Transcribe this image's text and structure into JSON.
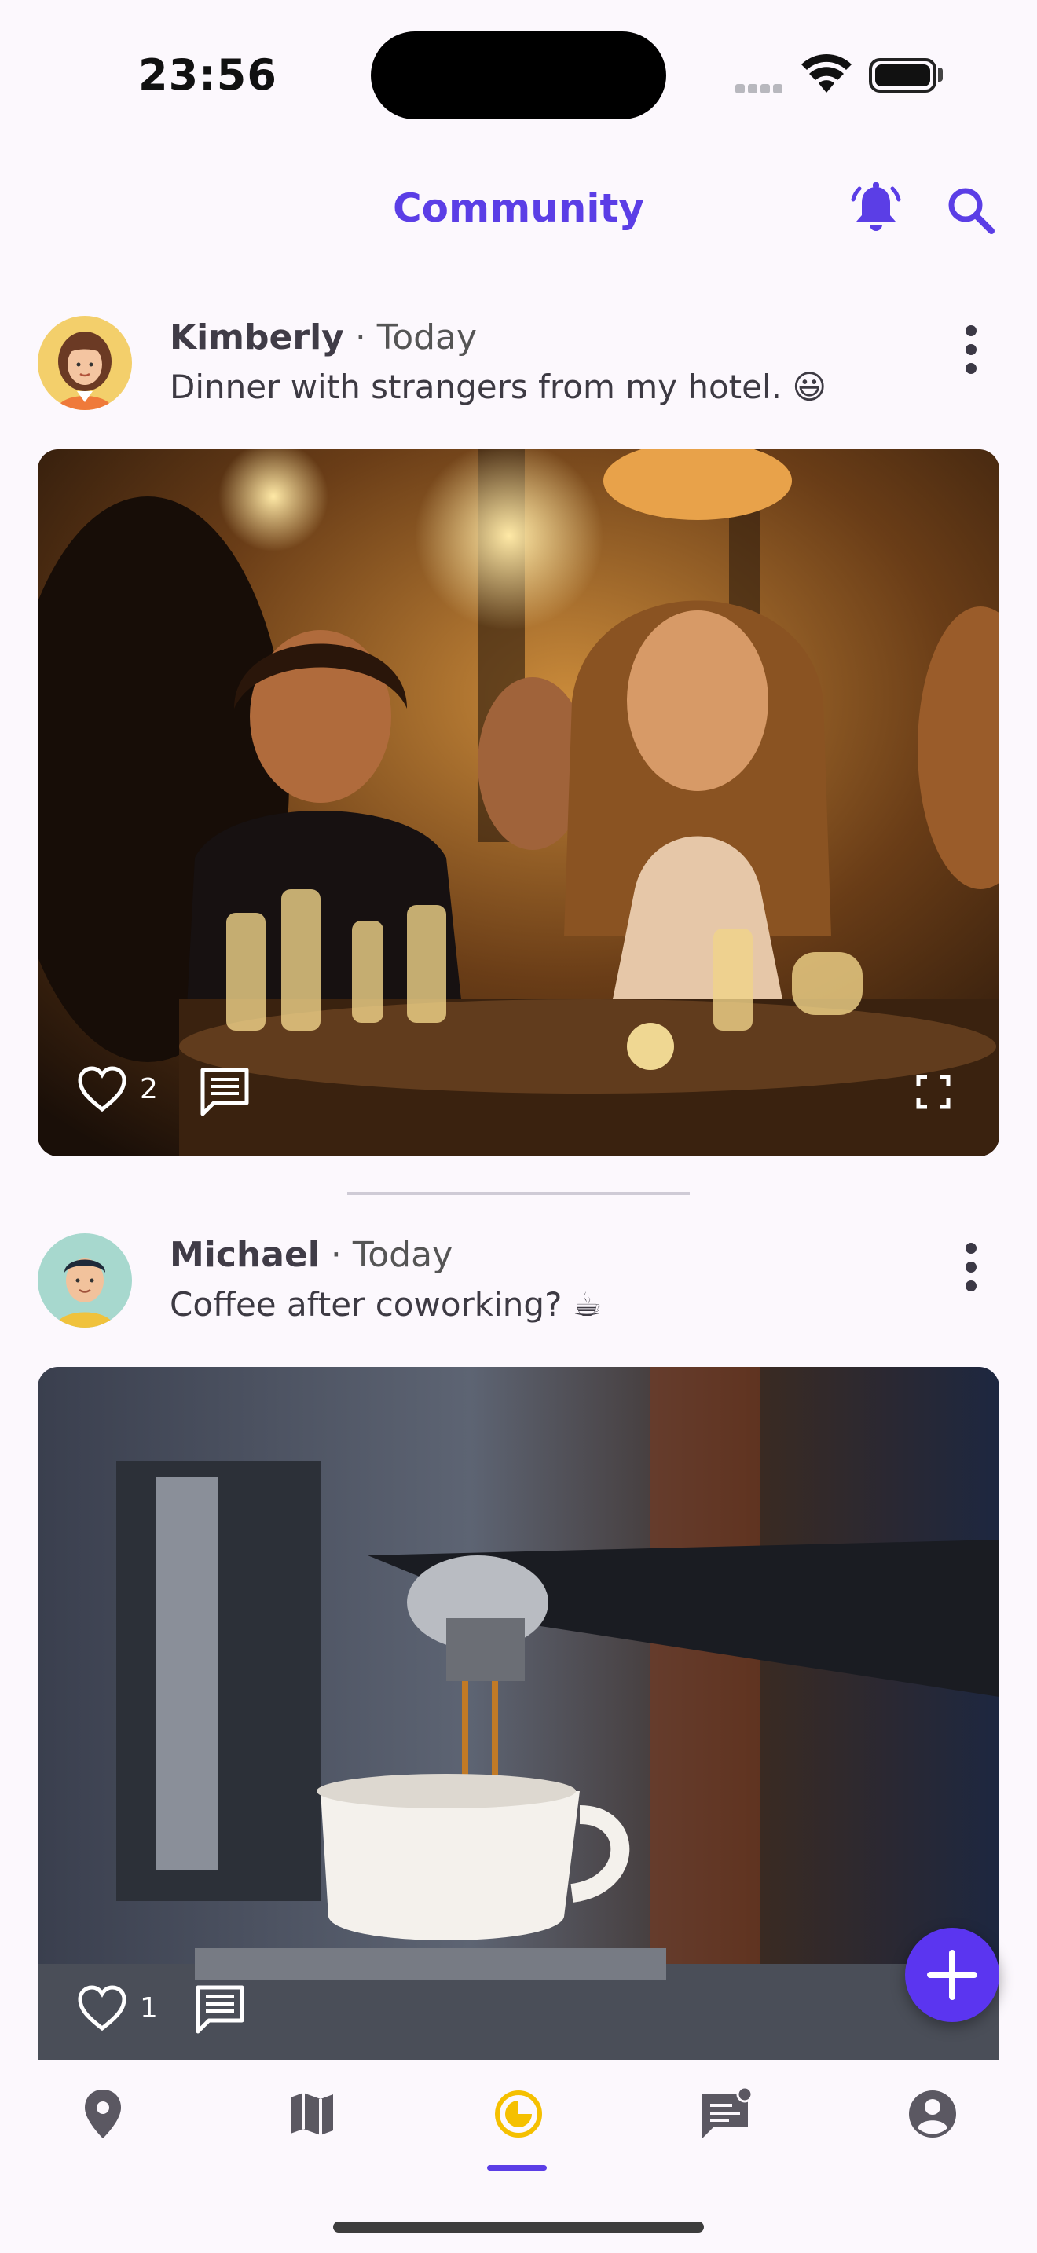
{
  "status_bar": {
    "time": "23:56"
  },
  "header": {
    "title": "Community"
  },
  "posts": [
    {
      "author": "Kimberly",
      "date": "· Today",
      "text": "Dinner with strangers from my hotel. 😃",
      "likes": "2"
    },
    {
      "author": "Michael",
      "date": "· Today",
      "text": "Coffee after coworking? ☕",
      "likes": "1"
    }
  ],
  "icons": {
    "header": [
      "bell-icon",
      "search-icon"
    ],
    "post_actions": [
      "heart-icon",
      "comment-icon",
      "fullscreen-icon",
      "more-vertical-icon"
    ],
    "nav": [
      "location-pin-icon",
      "map-icon",
      "timeline-icon",
      "chat-icon",
      "account-icon"
    ]
  },
  "colors": {
    "accent": "#5b3ee6",
    "fab": "#5b35f0",
    "active_nav": "#f5c000",
    "background": "#fcf8fd"
  },
  "bottom_nav": {
    "active_index": 2
  }
}
